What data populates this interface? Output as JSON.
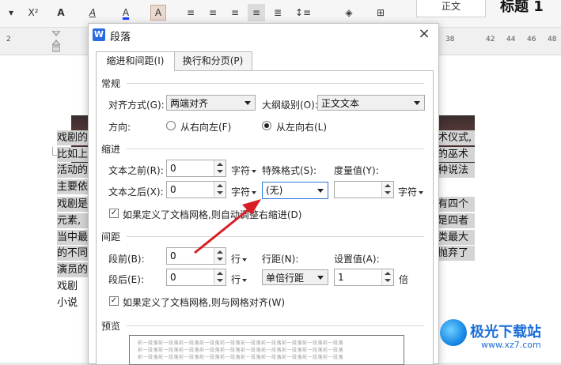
{
  "toolbar": {
    "superscript": "X²",
    "font_effects": "A",
    "highlight": "A",
    "font_color": "A",
    "char_shading": "A",
    "style_preview": "正文",
    "heading_preview": "标题 1"
  },
  "ruler": {
    "numbers": [
      "2",
      "38",
      "42",
      "44",
      "46",
      "48"
    ]
  },
  "document": {
    "lines": [
      {
        "left": "戏剧的",
        "right": "术仪式,"
      },
      {
        "left": "比如上",
        "right": "的巫术"
      },
      {
        "left": "活动的",
        "right": "种说法"
      },
      {
        "left": "主要依",
        "right": ""
      },
      {
        "left": "戏剧是",
        "right": "有四个"
      },
      {
        "left": "元素,",
        "right": "是四者"
      },
      {
        "left": "当中最",
        "right": "类最大"
      },
      {
        "left": "的不同",
        "right": "抛弃了"
      },
      {
        "left": "演员的",
        "right": ""
      },
      {
        "left": "戏剧",
        "right": ""
      },
      {
        "left": "小说",
        "right": ""
      }
    ]
  },
  "dialog": {
    "logo": "W",
    "title": "段落",
    "close": "×",
    "tabs": [
      "缩进和间距(I)",
      "换行和分页(P)"
    ],
    "general": {
      "heading": "常规",
      "alignment_label": "对齐方式(G):",
      "alignment_value": "两端对齐",
      "outline_label": "大纲级别(O):",
      "outline_value": "正文文本",
      "direction_label": "方向:",
      "rtl_label": "从右向左(F)",
      "ltr_label": "从左向右(L)"
    },
    "indent": {
      "heading": "缩进",
      "before_label": "文本之前(R):",
      "before_value": "0",
      "before_unit": "字符",
      "after_label": "文本之后(X):",
      "after_value": "0",
      "after_unit": "字符",
      "special_label": "特殊格式(S):",
      "special_value": "(无)",
      "measure_label": "度量值(Y):",
      "measure_value": "",
      "measure_unit": "字符",
      "grid_check": "如果定义了文档网格,则自动调整右缩进(D)"
    },
    "spacing": {
      "heading": "间距",
      "before_label": "段前(B):",
      "before_value": "0",
      "before_unit": "行",
      "after_label": "段后(E):",
      "after_value": "0",
      "after_unit": "行",
      "line_label": "行距(N):",
      "line_value": "单倍行距",
      "setting_label": "设置值(A):",
      "setting_value": "1",
      "setting_unit": "倍",
      "grid_check": "如果定义了文档网格,则与网格对齐(W)"
    },
    "preview": {
      "heading": "预览",
      "text": "前一段落前一段落前一段落前一段落前一段落前一段落前一段落前一段落前一段落前一段落"
    }
  },
  "watermark": {
    "name": "极光下载站",
    "url": "www.xz7.com"
  },
  "colors": {
    "accent": "#2b79d8",
    "arrow": "#d81f26",
    "logo_blue": "#2a6cdf"
  }
}
